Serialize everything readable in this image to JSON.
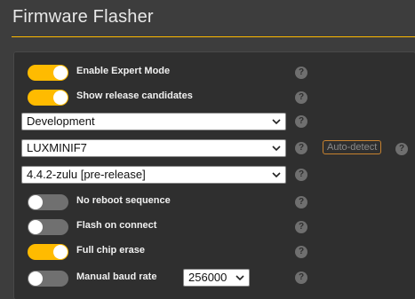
{
  "title": "Firmware Flasher",
  "options": {
    "expert_mode": {
      "label": "Enable Expert Mode",
      "on": true
    },
    "release_candidates": {
      "label": "Show release candidates",
      "on": true
    },
    "no_reboot": {
      "label": "No reboot sequence",
      "on": false
    },
    "flash_on_connect": {
      "label": "Flash on connect",
      "on": false
    },
    "full_chip_erase": {
      "label": "Full chip erase",
      "on": true
    },
    "manual_baud": {
      "label": "Manual baud rate",
      "on": false,
      "baud": "256000"
    }
  },
  "selects": {
    "build_type": "Development",
    "board": "LUXMINIF7",
    "firmware_version": "4.4.2-zulu [pre-release]"
  },
  "auto_detect_label": "Auto-detect",
  "help_glyph": "?",
  "colors": {
    "accent": "#ffbb00",
    "toggle_off": "#707070",
    "background": "#3d3d3d",
    "panel": "#2f2f2f"
  }
}
